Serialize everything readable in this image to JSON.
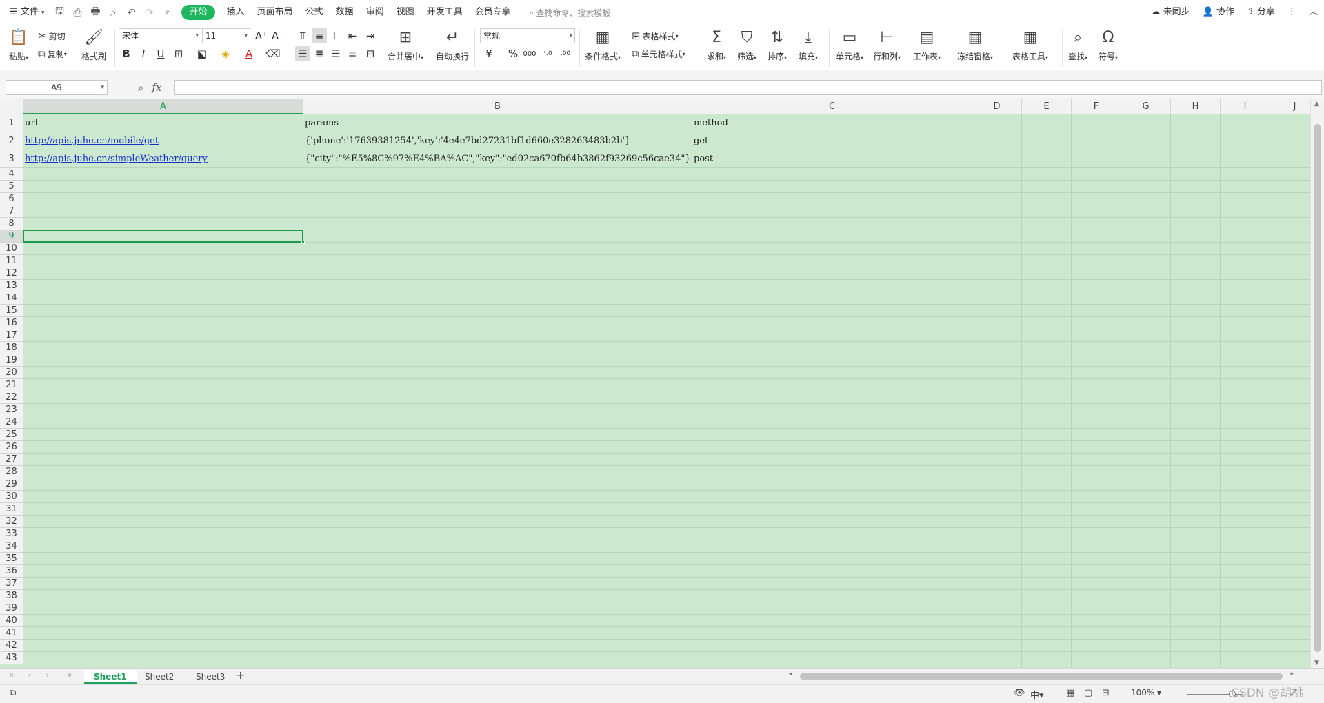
{
  "menu": {
    "file": "文件",
    "tabs": [
      "开始",
      "插入",
      "页面布局",
      "公式",
      "数据",
      "审阅",
      "视图",
      "开发工具",
      "会员专享"
    ],
    "search_placeholder": "查找命令、搜索模板",
    "right": {
      "sync": "未同步",
      "collab": "协作",
      "share": "分享"
    }
  },
  "ribbon": {
    "paste": "粘贴",
    "cut": "剪切",
    "copy": "复制",
    "format_painter": "格式刷",
    "font_name": "宋体",
    "font_size": "11",
    "merge_center": "合并居中",
    "wrap_text": "自动换行",
    "number_format": "常规",
    "cond_format": "条件格式",
    "table_style": "表格样式",
    "cell_style": "单元格样式",
    "sum": "求和",
    "filter": "筛选",
    "sort": "排序",
    "fill": "填充",
    "cells": "单元格",
    "rows_cols": "行和列",
    "worksheet": "工作表",
    "freeze": "冻结窗格",
    "table_tools": "表格工具",
    "find": "查找",
    "symbol": "符号"
  },
  "formula_bar": {
    "name_box": "A9",
    "fx": "fx",
    "content": ""
  },
  "sheet": {
    "columns": [
      "A",
      "B",
      "C",
      "D",
      "E",
      "F",
      "G",
      "H",
      "I",
      "J"
    ],
    "selected_column": "A",
    "selected_row": "9",
    "rows": [
      "1",
      "2",
      "3",
      "4",
      "5",
      "6",
      "7",
      "8",
      "9",
      "10",
      "11",
      "12",
      "13",
      "14",
      "15",
      "16",
      "17",
      "18",
      "19",
      "20",
      "21",
      "22",
      "23",
      "24",
      "25",
      "26",
      "27",
      "28",
      "29",
      "30",
      "31",
      "32",
      "33",
      "34",
      "35",
      "36",
      "37",
      "38",
      "39",
      "40",
      "41",
      "42",
      "43"
    ],
    "cells": {
      "A1": "url",
      "B1": "params",
      "C1": "method",
      "A2": "http://apis.juhe.cn/mobile/get",
      "B2": "{'phone':'17639381254','key':'4e4e7bd27231bf1d660e328263483b2b'}",
      "C2": "get",
      "A3": "http://apis.juhe.cn/simpleWeather/query",
      "B3": "{\"city\":\"%E5%8C%97%E4%BA%AC\",\"key\":\"ed02ca670fb64b3862f93269c56cae34\"}",
      "C3": "post"
    }
  },
  "sheet_tabs": [
    "Sheet1",
    "Sheet2",
    "Sheet3"
  ],
  "active_sheet": "Sheet1",
  "status": {
    "zoom": "100%"
  },
  "watermark": "CSDN @胡桃"
}
